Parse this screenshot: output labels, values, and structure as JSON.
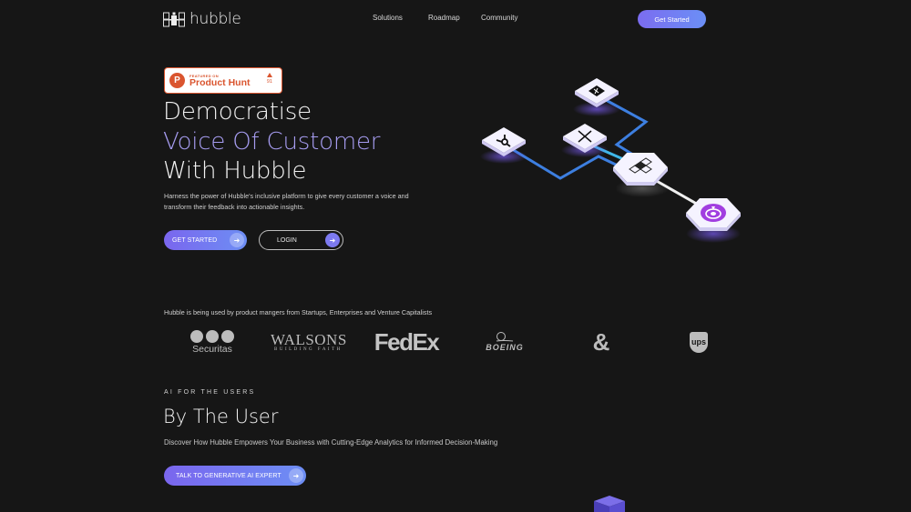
{
  "nav": {
    "brand": "hubble",
    "links": [
      "Solutions",
      "Roadmap",
      "Community"
    ],
    "cta": "Get Started"
  },
  "hero": {
    "badge": {
      "small": "FEATURED ON",
      "title": "Product Hunt",
      "votes": "91",
      "color": "#da552f"
    },
    "title_line1": "Democratise",
    "title_line2": "Voice Of Customer",
    "title_line3": "With Hubble",
    "description": "Harness the power of Hubble's inclusive platform to give every customer a voice and transform their feedback into actionable insights.",
    "primary_button": "GET STARTED",
    "secondary_button": "LOGIN",
    "accent_color": "#a69cf0",
    "illustration": {
      "nodes": [
        "hubspot-icon",
        "x-twitter-icon",
        "app-store-icon",
        "hubble-logo-icon",
        "target-icon"
      ]
    }
  },
  "clients": {
    "intro": "Hubble is being used by product mangers from Startups, Enterprises and Venture Capitalists",
    "logos": [
      {
        "name": "Securitas",
        "label": "Securitas"
      },
      {
        "name": "Walsons",
        "label": "WALSONS",
        "tagline": "BUILDING FAITH"
      },
      {
        "name": "FedEx",
        "label": "FedEx"
      },
      {
        "name": "Boeing",
        "label": "BOEING"
      },
      {
        "name": "Ampersand",
        "label": "&"
      },
      {
        "name": "UPS",
        "label": "ups"
      }
    ]
  },
  "section2": {
    "eyebrow": "AI FOR THE USERS",
    "title": "By The User",
    "subtitle": "Discover How Hubble Empowers Your Business with Cutting-Edge Analytics for Informed Decision-Making",
    "button": "TALK TO GENERATIVE AI EXPERT"
  }
}
